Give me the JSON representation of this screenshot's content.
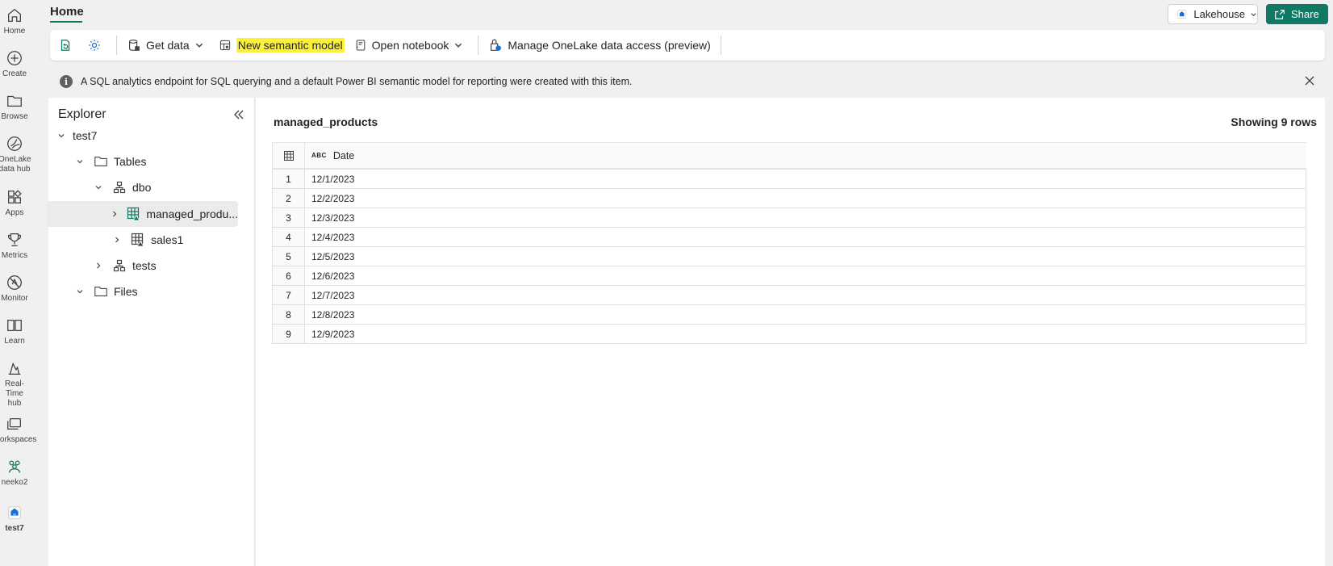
{
  "rail": [
    {
      "label": "Home",
      "icon": "home-icon"
    },
    {
      "label": "Create",
      "icon": "create-icon"
    },
    {
      "label": "Browse",
      "icon": "folder-icon"
    },
    {
      "label": "OneLake data hub",
      "icon": "onelake-icon"
    },
    {
      "label": "Apps",
      "icon": "apps-icon"
    },
    {
      "label": "Metrics",
      "icon": "trophy-icon"
    },
    {
      "label": "Monitor",
      "icon": "monitor-icon"
    },
    {
      "label": "Learn",
      "icon": "book-icon"
    },
    {
      "label": "Real-Time hub",
      "icon": "realtime-icon"
    },
    {
      "label": "Workspaces",
      "icon": "workspaces-icon"
    },
    {
      "label": "neeko2",
      "icon": "workspace-people-icon"
    },
    {
      "label": "test7",
      "icon": "lakehouse-icon"
    }
  ],
  "topbar": {
    "home_tab": "Home",
    "lakehouse_label": "Lakehouse",
    "share_label": "Share"
  },
  "toolbar": {
    "get_data": "Get data",
    "new_semantic_model": "New semantic model",
    "open_notebook": "Open notebook",
    "manage_access": "Manage OneLake data access (preview)"
  },
  "banner": {
    "text": "A SQL analytics endpoint for SQL querying and a default Power BI semantic model for reporting were created with this item."
  },
  "explorer": {
    "title": "Explorer",
    "root": "test7",
    "tables": "Tables",
    "schema": "dbo",
    "table_selected": "managed_produ...",
    "table_other": "sales1",
    "schema2": "tests",
    "files": "Files"
  },
  "main": {
    "table_name": "managed_products",
    "rows_count": "Showing 9 rows",
    "column_type": "ABC",
    "column_name": "Date",
    "rows": [
      {
        "n": "1",
        "date": "12/1/2023"
      },
      {
        "n": "2",
        "date": "12/2/2023"
      },
      {
        "n": "3",
        "date": "12/3/2023"
      },
      {
        "n": "4",
        "date": "12/4/2023"
      },
      {
        "n": "5",
        "date": "12/5/2023"
      },
      {
        "n": "6",
        "date": "12/6/2023"
      },
      {
        "n": "7",
        "date": "12/7/2023"
      },
      {
        "n": "8",
        "date": "12/8/2023"
      },
      {
        "n": "9",
        "date": "12/9/2023"
      }
    ]
  },
  "colors": {
    "accent": "#117865",
    "highlight": "#fbf13b"
  }
}
